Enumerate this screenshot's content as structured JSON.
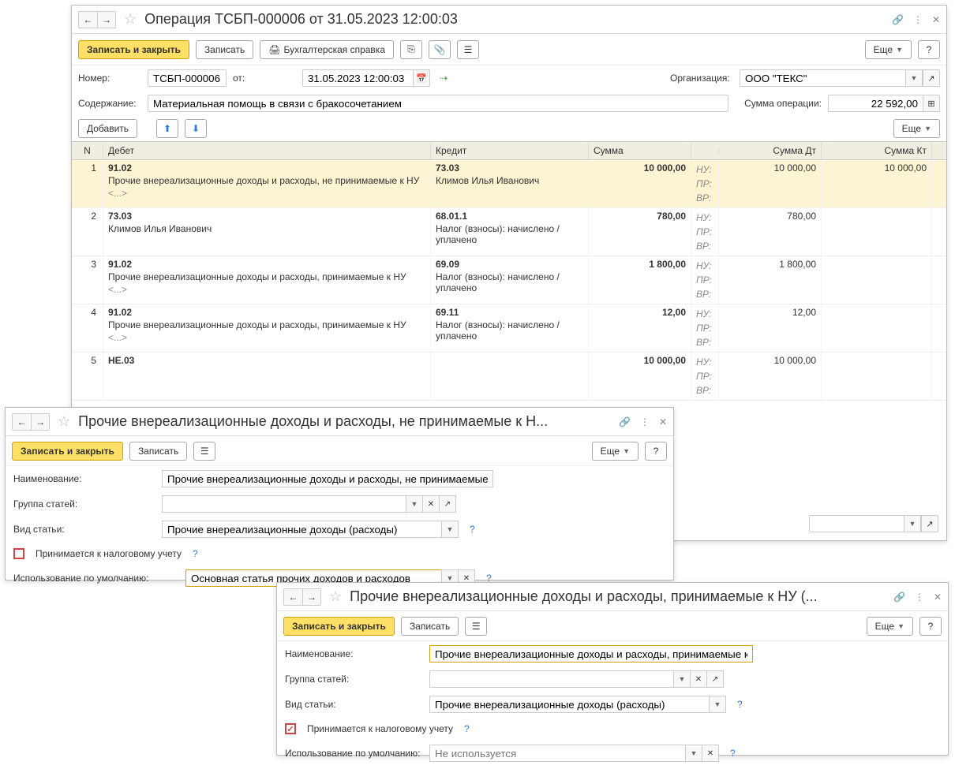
{
  "main": {
    "title": "Операция ТСБП-000006 от 31.05.2023 12:00:03",
    "btn_save_close": "Записать и закрыть",
    "btn_save": "Записать",
    "btn_acct": "Бухгалтерская справка",
    "btn_more": "Еще",
    "label_number": "Номер:",
    "number": "ТСБП-000006",
    "label_from": "от:",
    "date": "31.05.2023 12:00:03",
    "label_org": "Организация:",
    "org": "ООО \"ТЕКС\"",
    "label_content": "Содержание:",
    "content": "Материальная помощь в связи с бракосочетанием",
    "label_opsum": "Сумма операции:",
    "opsum": "22 592,00",
    "btn_add": "Добавить"
  },
  "headers": {
    "n": "N",
    "debit": "Дебет",
    "credit": "Кредит",
    "sum": "Сумма",
    "sdt": "Сумма Дт",
    "skt": "Сумма Кт"
  },
  "tags": {
    "nu": "НУ:",
    "pr": "ПР:",
    "vr": "ВР:"
  },
  "rows": [
    {
      "n": "1",
      "selected": true,
      "d_acct": "91.02",
      "d_desc": "Прочие внереализационные доходы и расходы, не принимаемые к НУ",
      "d_sub": "<...>",
      "c_acct": "73.03",
      "c_desc": "Климов Илья Иванович",
      "sum": "10 000,00",
      "sdt": "10 000,00",
      "skt": "10 000,00"
    },
    {
      "n": "2",
      "d_acct": "73.03",
      "d_desc": "Климов Илья Иванович",
      "d_sub": "",
      "c_acct": "68.01.1",
      "c_desc": "Налог (взносы): начислено / уплачено",
      "sum": "780,00",
      "sdt": "780,00",
      "skt": ""
    },
    {
      "n": "3",
      "d_acct": "91.02",
      "d_desc": "Прочие внереализационные доходы и расходы, принимаемые к НУ",
      "d_sub": "<...>",
      "c_acct": "69.09",
      "c_desc": "Налог (взносы): начислено / уплачено",
      "sum": "1 800,00",
      "sdt": "1 800,00",
      "skt": ""
    },
    {
      "n": "4",
      "d_acct": "91.02",
      "d_desc": "Прочие внереализационные доходы и расходы, принимаемые к НУ",
      "d_sub": "<...>",
      "c_acct": "69.11",
      "c_desc": "Налог (взносы): начислено / уплачено",
      "sum": "12,00",
      "sdt": "12,00",
      "skt": ""
    },
    {
      "n": "5",
      "d_acct": "НЕ.03",
      "d_desc": "",
      "d_sub": "",
      "c_acct": "",
      "c_desc": "",
      "sum": "10 000,00",
      "sdt": "10 000,00",
      "skt": ""
    }
  ],
  "sub": {
    "title1": "Прочие внереализационные доходы и расходы, не принимаемые к Н...",
    "title2": "Прочие внереализационные доходы и расходы, принимаемые к НУ (...",
    "btn_save_close": "Записать и закрыть",
    "btn_save": "Записать",
    "btn_more": "Еще",
    "label_name": "Наименование:",
    "name1": "Прочие внереализационные доходы и расходы, не принимаемые к НУ",
    "name2": "Прочие внереализационные доходы и расходы, принимаемые к НУ",
    "label_group": "Группа статей:",
    "label_type": "Вид статьи:",
    "type_value": "Прочие внереализационные доходы (расходы)",
    "label_tax": "Принимается к налоговому учету",
    "label_default": "Использование по умолчанию:",
    "default1": "Основная статья прочих доходов и расходов",
    "default2_placeholder": "Не используется"
  }
}
